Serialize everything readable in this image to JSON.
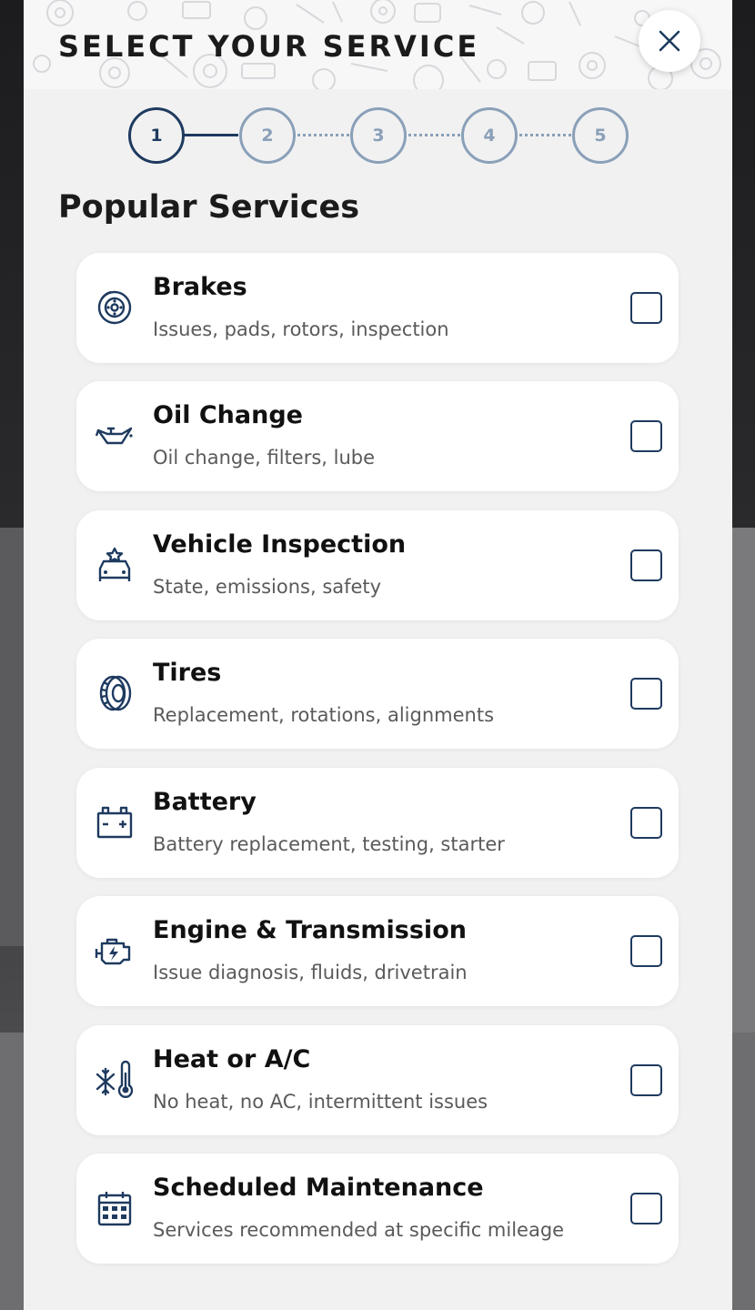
{
  "modal": {
    "title": "SELECT YOUR SERVICE",
    "close_icon": "close-icon"
  },
  "stepper": {
    "steps": [
      "1",
      "2",
      "3",
      "4",
      "5"
    ],
    "active_step": 1
  },
  "section": {
    "title": "Popular Services"
  },
  "services": [
    {
      "name": "Brakes",
      "description": "Issues, pads, rotors, inspection",
      "icon": "brake-disc-icon"
    },
    {
      "name": "Oil Change",
      "description": "Oil change, filters, lube",
      "icon": "oil-can-icon"
    },
    {
      "name": "Vehicle Inspection",
      "description": "State, emissions, safety",
      "icon": "car-inspection-icon"
    },
    {
      "name": "Tires",
      "description": "Replacement, rotations, alignments",
      "icon": "tire-icon"
    },
    {
      "name": "Battery",
      "description": "Battery replacement, testing, starter",
      "icon": "battery-icon"
    },
    {
      "name": "Engine & Transmission",
      "description": "Issue diagnosis, fluids, drivetrain",
      "icon": "engine-icon"
    },
    {
      "name": "Heat or A/C",
      "description": "No heat, no AC, intermittent issues",
      "icon": "snowflake-thermometer-icon"
    },
    {
      "name": "Scheduled Maintenance",
      "description": "Services recommended at specific mileage",
      "icon": "calendar-icon"
    }
  ],
  "colors": {
    "primary": "#1e3a5f",
    "inactive_step": "#8aa0b8",
    "background": "#f1f1f2",
    "card": "#ffffff"
  }
}
